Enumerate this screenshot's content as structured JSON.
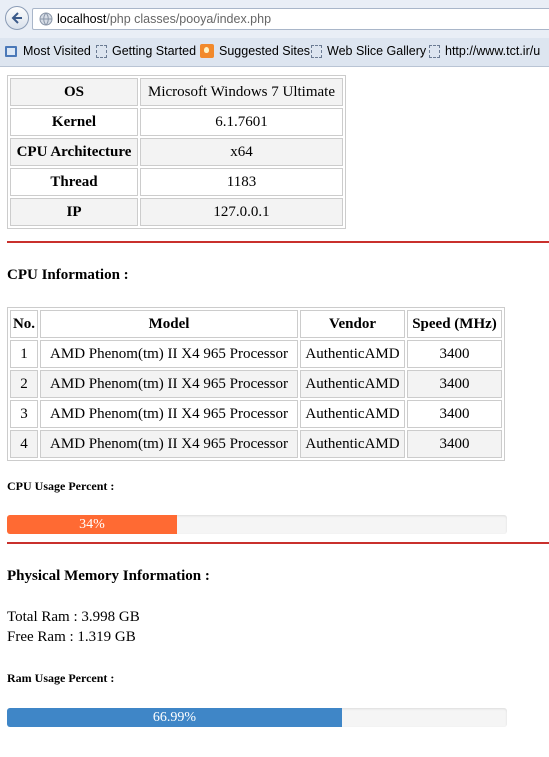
{
  "browser": {
    "url_host": "localhost",
    "url_path": "/php classes/pooya/index.php",
    "bookmarks": [
      {
        "label": "Most Visited",
        "icon": "bookmarks-icon"
      },
      {
        "label": "Getting Started",
        "icon": "page-icon"
      },
      {
        "label": "Suggested Sites",
        "icon": "suggested-sites-icon"
      },
      {
        "label": "Web Slice Gallery",
        "icon": "page-icon"
      },
      {
        "label": "http://www.tct.ir/u",
        "icon": "page-icon"
      }
    ]
  },
  "system": {
    "rows": [
      {
        "label": "OS",
        "value": "Microsoft Windows 7 Ultimate"
      },
      {
        "label": "Kernel",
        "value": "6.1.7601"
      },
      {
        "label": "CPU Architecture",
        "value": "x64"
      },
      {
        "label": "Thread",
        "value": "1183"
      },
      {
        "label": "IP",
        "value": "127.0.0.1"
      }
    ]
  },
  "cpu": {
    "title": "CPU Information :",
    "headers": [
      "No.",
      "Model",
      "Vendor",
      "Speed (MHz)"
    ],
    "rows": [
      [
        "1",
        "AMD Phenom(tm) II X4 965 Processor",
        "AuthenticAMD",
        "3400"
      ],
      [
        "2",
        "AMD Phenom(tm) II X4 965 Processor",
        "AuthenticAMD",
        "3400"
      ],
      [
        "3",
        "AMD Phenom(tm) II X4 965 Processor",
        "AuthenticAMD",
        "3400"
      ],
      [
        "4",
        "AMD Phenom(tm) II X4 965 Processor",
        "AuthenticAMD",
        "3400"
      ]
    ],
    "usage_title": "CPU Usage Percent :",
    "usage_label": "34%",
    "usage_fraction": 0.34,
    "usage_color": "#ff6a33"
  },
  "memory": {
    "title": "Physical Memory Information :",
    "total": "Total Ram : 3.998 GB",
    "free": "Free Ram : 1.319 GB",
    "usage_title": "Ram Usage Percent :",
    "usage_label": "66.99%",
    "usage_fraction": 0.6699,
    "usage_color": "#3f86c7"
  },
  "colors": {
    "divider": "#c9302c",
    "table_border": "#cccccc"
  }
}
